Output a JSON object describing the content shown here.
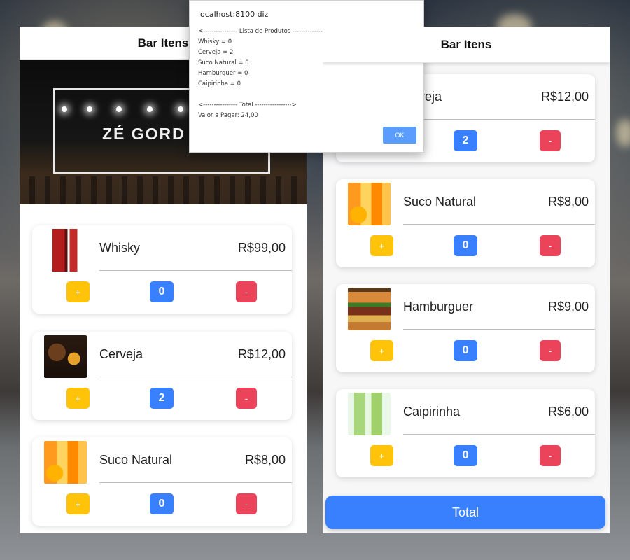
{
  "left_screen": {
    "header_title": "Bar Itens",
    "banner_logo": "ZÉ GORD",
    "products": [
      {
        "name": "Whisky",
        "price": "R$99,00",
        "plus": "+",
        "count": "0",
        "minus": "-"
      },
      {
        "name": "Cerveja",
        "price": "R$12,00",
        "plus": "+",
        "count": "2",
        "minus": "-"
      },
      {
        "name": "Suco Natural",
        "price": "R$8,00",
        "plus": "+",
        "count": "0",
        "minus": "-"
      }
    ]
  },
  "right_screen": {
    "header_title": "Bar Itens",
    "products": [
      {
        "name": "Cerveja",
        "visible_name": "veja",
        "price": "R$12,00",
        "plus": "+",
        "count": "2",
        "minus": "-"
      },
      {
        "name": "Suco Natural",
        "price": "R$8,00",
        "plus": "+",
        "count": "0",
        "minus": "-"
      },
      {
        "name": "Hamburguer",
        "price": "R$9,00",
        "plus": "+",
        "count": "0",
        "minus": "-"
      },
      {
        "name": "Caipirinha",
        "price": "R$6,00",
        "plus": "+",
        "count": "0",
        "minus": "-"
      }
    ],
    "total_label": "Total"
  },
  "dialog": {
    "title": "localhost:8100 diz",
    "message": "<---------------- Lista de Produtos -------------->\nWhisky = 0\nCerveja = 2\nSuco Natural = 0\nHamburguer = 0\nCaipirinha = 0\n\n<---------------- Total ----------------->\nValor a Pagar: 24,00",
    "ok_label": "OK"
  },
  "colors": {
    "plus": "#ffc409",
    "count": "#3880ff",
    "minus": "#eb445a",
    "total": "#3880ff"
  },
  "icons": {
    "whisky": "whisky-bottle-image",
    "cerveja": "beer-image",
    "suco": "juice-image",
    "hamburguer": "burger-image",
    "caipirinha": "caipirinha-image"
  }
}
